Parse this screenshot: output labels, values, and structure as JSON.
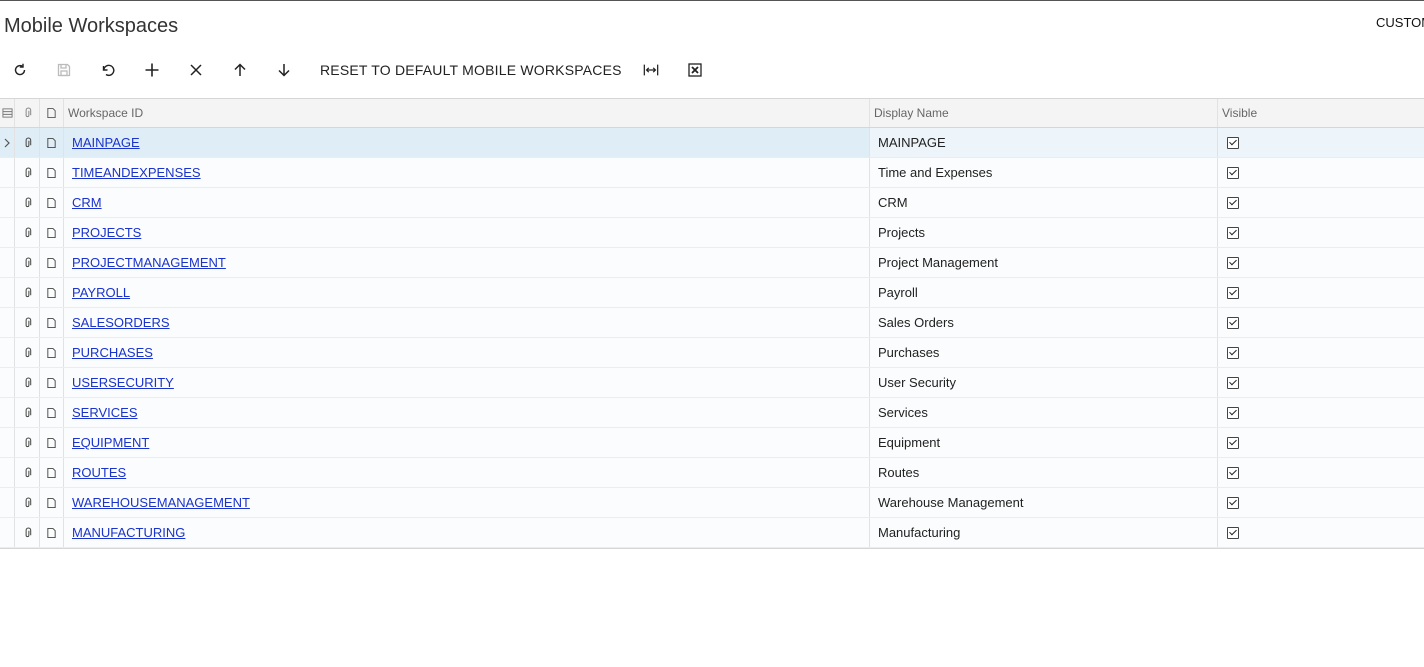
{
  "page": {
    "title": "Mobile Workspaces",
    "customization_label": "CUSTOMIZATION"
  },
  "toolbar": {
    "refresh_icon": "refresh-icon",
    "save_icon": "save-icon",
    "undo_icon": "undo-icon",
    "add_icon": "plus-icon",
    "delete_icon": "close-icon",
    "move_up_icon": "arrow-up-icon",
    "move_down_icon": "arrow-down-icon",
    "reset_label": "RESET TO DEFAULT MOBILE WORKSPACES",
    "fit_columns_icon": "fit-to-screen-icon",
    "export_excel_icon": "excel-icon"
  },
  "grid": {
    "columns": {
      "workspace_id": "Workspace ID",
      "display_name": "Display Name",
      "visible": "Visible"
    },
    "rows": [
      {
        "id": "MAINPAGE",
        "name": "MAINPAGE",
        "visible": true
      },
      {
        "id": "TIMEANDEXPENSES",
        "name": "Time and Expenses",
        "visible": true
      },
      {
        "id": "CRM",
        "name": "CRM",
        "visible": true
      },
      {
        "id": "PROJECTS",
        "name": "Projects",
        "visible": true
      },
      {
        "id": "PROJECTMANAGEMENT",
        "name": "Project Management",
        "visible": true
      },
      {
        "id": "PAYROLL",
        "name": "Payroll",
        "visible": true
      },
      {
        "id": "SALESORDERS",
        "name": "Sales Orders",
        "visible": true
      },
      {
        "id": "PURCHASES",
        "name": "Purchases",
        "visible": true
      },
      {
        "id": "USERSECURITY",
        "name": "User Security",
        "visible": true
      },
      {
        "id": "SERVICES",
        "name": "Services",
        "visible": true
      },
      {
        "id": "EQUIPMENT",
        "name": "Equipment",
        "visible": true
      },
      {
        "id": "ROUTES",
        "name": "Routes",
        "visible": true
      },
      {
        "id": "WAREHOUSEMANAGEMENT",
        "name": "Warehouse Management",
        "visible": true
      },
      {
        "id": "MANUFACTURING",
        "name": "Manufacturing",
        "visible": true
      }
    ]
  }
}
